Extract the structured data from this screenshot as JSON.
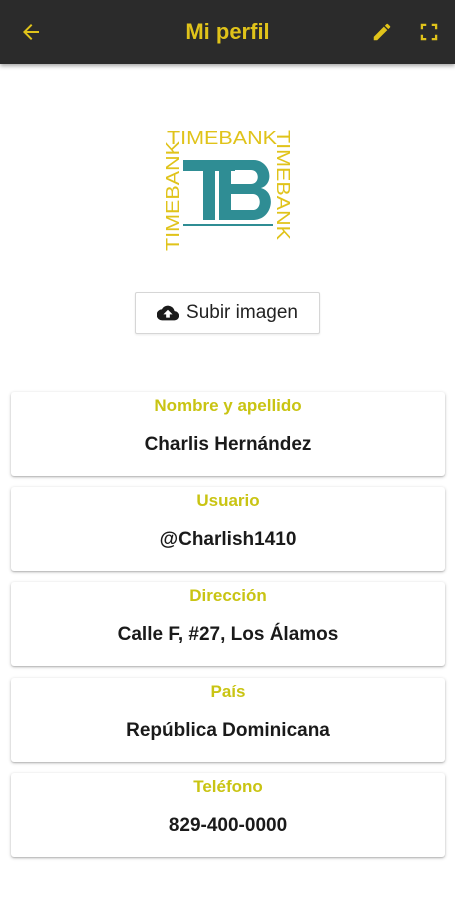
{
  "header": {
    "title": "Mi perfil",
    "back_icon": "arrow-left-icon",
    "edit_icon": "pencil-icon",
    "fullscreen_icon": "fullscreen-icon",
    "accent_color": "#e0c31a",
    "background_color": "#2b2b2b"
  },
  "logo": {
    "word": "TIMEBANK",
    "monogram": "TB"
  },
  "upload": {
    "label": "Subir imagen",
    "icon": "cloud-upload-icon"
  },
  "fields": [
    {
      "label": "Nombre y apellido",
      "value": "Charlis Hernández"
    },
    {
      "label": "Usuario",
      "value": "@Charlish1410"
    },
    {
      "label": "Dirección",
      "value": "Calle F, #27, Los Álamos"
    },
    {
      "label": "País",
      "value": "República Dominicana"
    },
    {
      "label": "Teléfono",
      "value": "829-400-0000"
    }
  ]
}
